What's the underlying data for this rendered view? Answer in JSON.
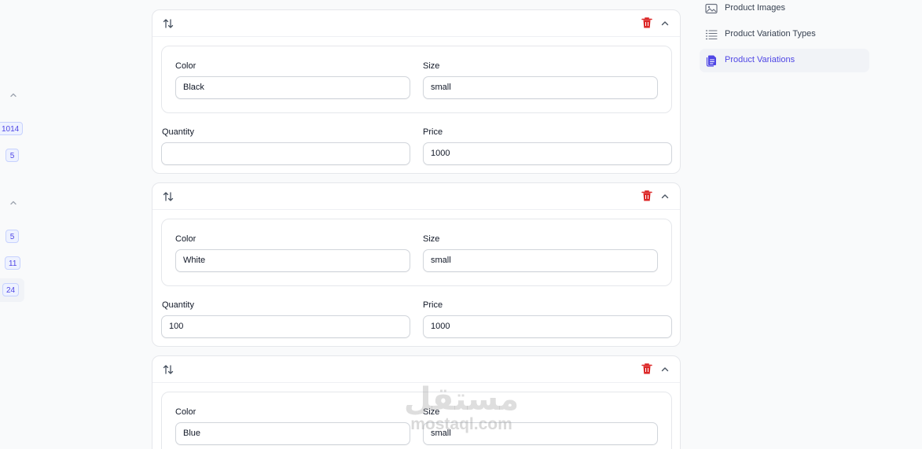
{
  "left_strip": {
    "badges": [
      "1014",
      "5",
      "5",
      "11",
      "24"
    ]
  },
  "variations": [
    {
      "color_label": "Color",
      "color_value": "Black",
      "size_label": "Size",
      "size_value": "small",
      "quantity_label": "Quantity",
      "quantity_value": "",
      "price_label": "Price",
      "price_value": "1000"
    },
    {
      "color_label": "Color",
      "color_value": "White",
      "size_label": "Size",
      "size_value": "small",
      "quantity_label": "Quantity",
      "quantity_value": "100",
      "price_label": "Price",
      "price_value": "1000"
    },
    {
      "color_label": "Color",
      "color_value": "Blue",
      "size_label": "Size",
      "size_value": "small"
    }
  ],
  "right_nav": {
    "items": [
      {
        "label": "Product Images",
        "icon": "image-icon",
        "active": false
      },
      {
        "label": "Product Variation Types",
        "icon": "list-icon",
        "active": false
      },
      {
        "label": "Product Variations",
        "icon": "documents-icon",
        "active": true
      }
    ]
  },
  "watermark": {
    "arabic": "مستقل",
    "latin": "mostaql.com"
  },
  "colors": {
    "accent": "#4f46e5",
    "danger": "#dc2626",
    "border": "#e5e7eb",
    "page_bg": "#f9fafb"
  }
}
